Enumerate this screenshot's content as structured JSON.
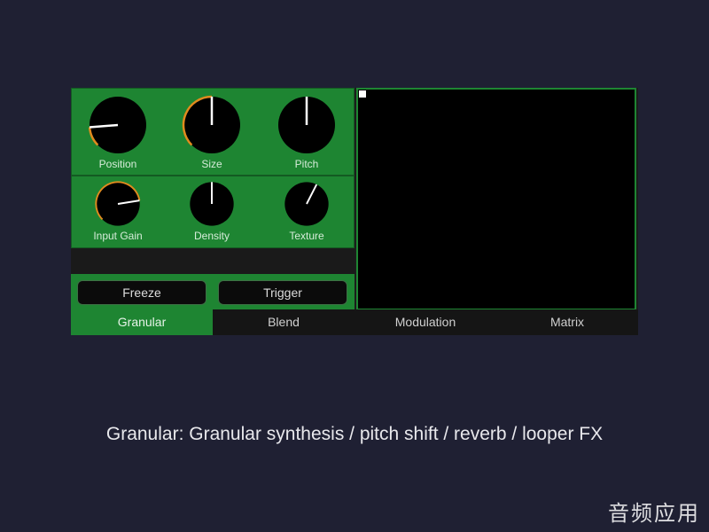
{
  "plugin": {
    "knobs_top": [
      {
        "label": "Position",
        "value": 0.15,
        "accent": true
      },
      {
        "label": "Size",
        "value": 0.5,
        "accent": true
      },
      {
        "label": "Pitch",
        "value": 0.5,
        "accent": false
      }
    ],
    "knobs_mid": [
      {
        "label": "Input Gain",
        "value": 0.8,
        "accent": true
      },
      {
        "label": "Density",
        "value": 0.5,
        "accent": false
      },
      {
        "label": "Texture",
        "value": 0.6,
        "accent": false
      }
    ],
    "buttons": {
      "freeze_label": "Freeze",
      "trigger_label": "Trigger"
    },
    "tabs": [
      {
        "label": "Granular",
        "active": true
      },
      {
        "label": "Blend",
        "active": false
      },
      {
        "label": "Modulation",
        "active": false
      },
      {
        "label": "Matrix",
        "active": false
      }
    ],
    "xy_pad": {
      "x": 0.0,
      "y": 1.0
    }
  },
  "caption": "Granular: Granular synthesis / pitch shift / reverb / looper FX",
  "watermark": "音频应用",
  "colors": {
    "background": "#1f2033",
    "panel_green": "#1e8532",
    "knob_accent": "#e08a1e",
    "knob_body": "#000000",
    "indicator": "#ffffff"
  }
}
